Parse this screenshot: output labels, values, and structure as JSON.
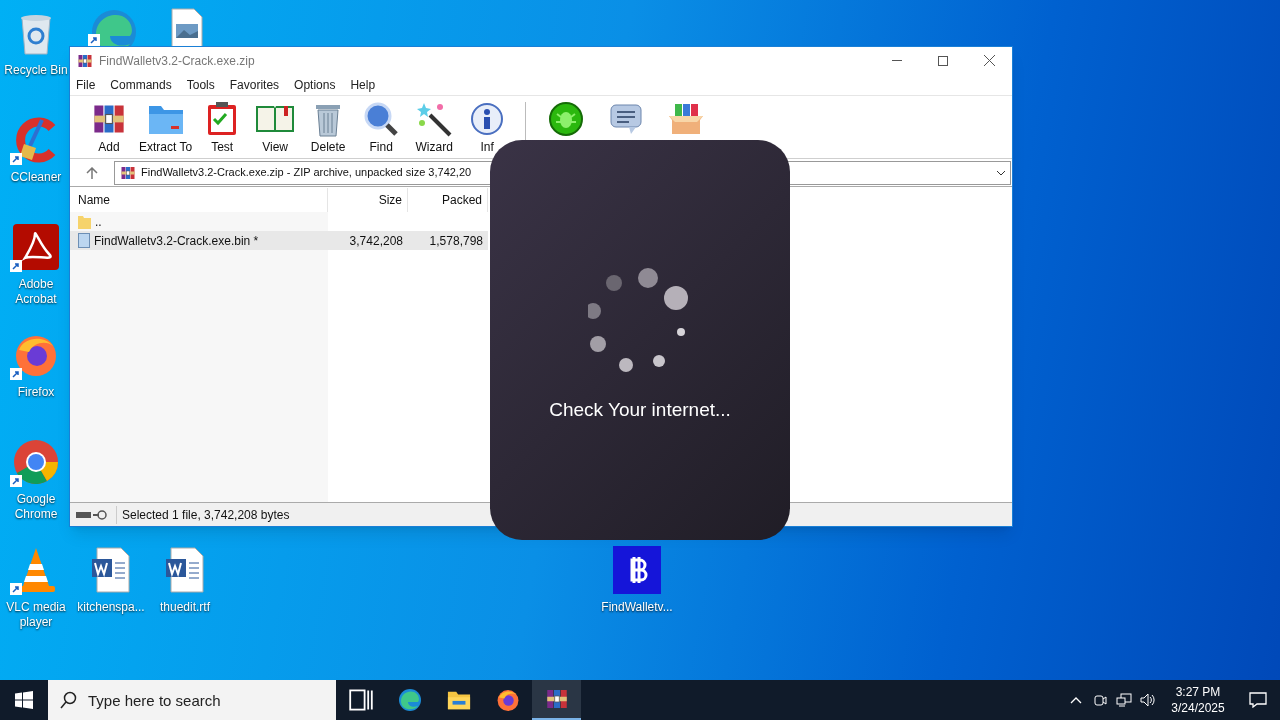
{
  "desktop_icons": [
    {
      "kind": "recycle",
      "label": "Recycle Bin",
      "shortcut": false
    },
    {
      "kind": "ccleaner",
      "label": "CCleaner",
      "shortcut": true
    },
    {
      "kind": "pdf",
      "label": "Adobe Acrobat",
      "shortcut": true
    },
    {
      "kind": "firefox",
      "label": "Firefox",
      "shortcut": true
    },
    {
      "kind": "chrome",
      "label": "Google Chrome",
      "shortcut": true
    },
    {
      "kind": "vlc",
      "label": "VLC media player",
      "shortcut": true
    },
    {
      "kind": "edge",
      "shortcut": true
    },
    {
      "kind": "image",
      "shortcut": false
    },
    {
      "kind": "word",
      "label": "kitchenspa...",
      "shortcut": false
    },
    {
      "kind": "word",
      "label": "thuedit.rtf",
      "shortcut": false
    },
    {
      "kind": "bitcoin",
      "label": "FindWalletv...",
      "shortcut": false
    }
  ],
  "window": {
    "title": "FindWalletv3.2-Crack.exe.zip",
    "menu": [
      "File",
      "Commands",
      "Tools",
      "Favorites",
      "Options",
      "Help"
    ],
    "toolbar": [
      {
        "kind": "add",
        "label": "Add"
      },
      {
        "kind": "extract",
        "label": "Extract To"
      },
      {
        "kind": "test",
        "label": "Test"
      },
      {
        "kind": "view",
        "label": "View"
      },
      {
        "kind": "delete",
        "label": "Delete"
      },
      {
        "kind": "find",
        "label": "Find"
      },
      {
        "kind": "wizard",
        "label": "Wizard"
      },
      {
        "kind": "info",
        "label": "Inf"
      },
      {
        "kind": "bug"
      },
      {
        "kind": "comment"
      },
      {
        "kind": "sfx"
      }
    ],
    "path": "FindWalletv3.2-Crack.exe.zip - ZIP archive, unpacked size 3,742,20",
    "columns": [
      "Name",
      "Size",
      "Packed"
    ],
    "rows": [
      {
        "kind": "parent",
        "name": "..",
        "selected": false
      },
      {
        "kind": "file",
        "name": "FindWalletv3.2-Crack.exe.bin *",
        "size": "3,742,208",
        "packed": "1,578,798",
        "selected": true
      }
    ],
    "status": "Selected 1 file, 3,742,208 bytes"
  },
  "dialog": {
    "message": "Check Your internet..."
  },
  "taskbar": {
    "search_placeholder": "Type here to search",
    "apps": [
      {
        "kind": "taskview",
        "selected": false
      },
      {
        "kind": "edge",
        "selected": false
      },
      {
        "kind": "explorer",
        "selected": false
      },
      {
        "kind": "firefox",
        "selected": false
      },
      {
        "kind": "winrar",
        "selected": true
      }
    ],
    "time": "3:27 PM",
    "date": "3/24/2025"
  }
}
